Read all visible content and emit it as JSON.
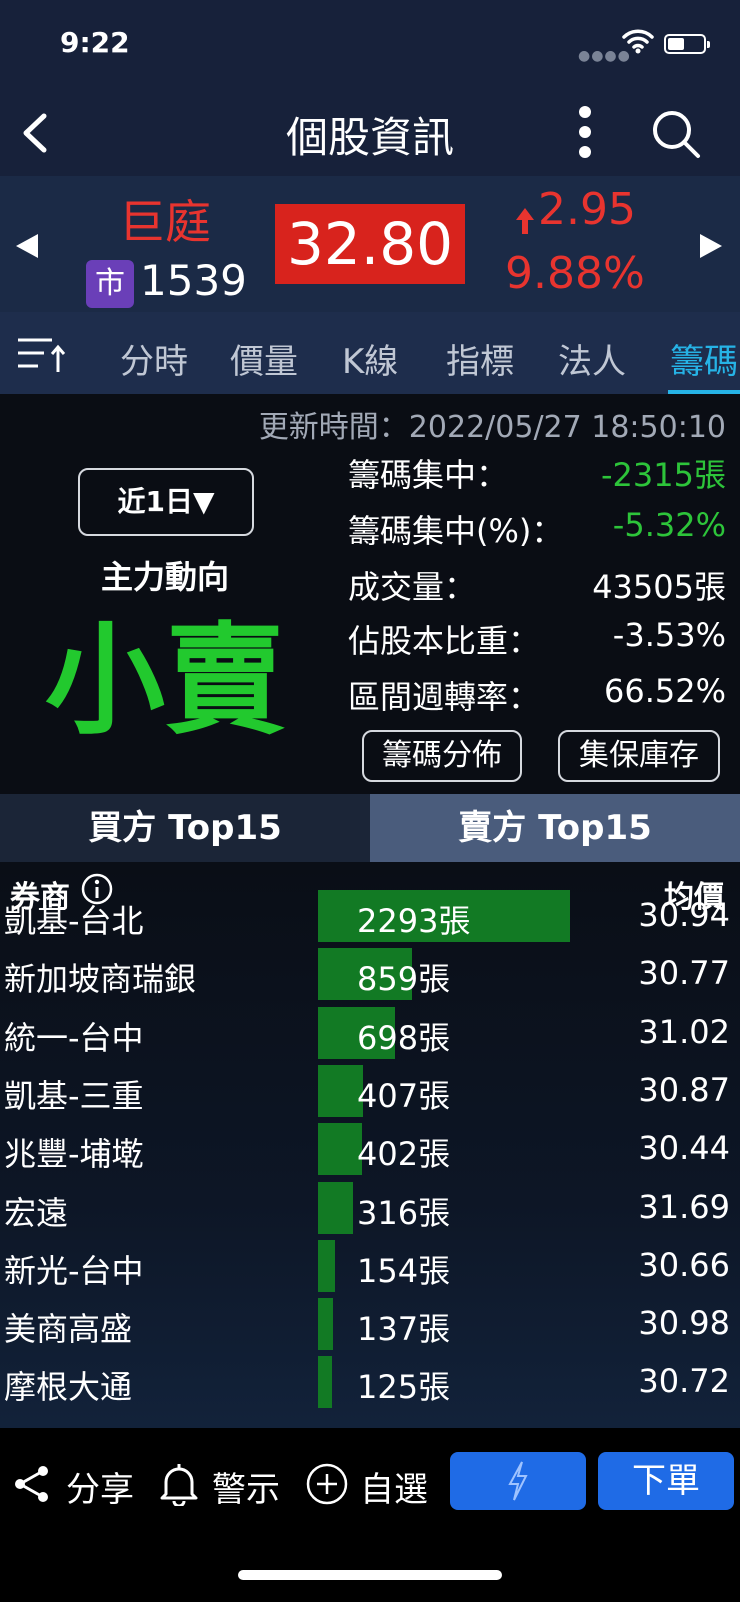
{
  "status": {
    "time": "9:22"
  },
  "nav": {
    "title": "個股資訊"
  },
  "stock": {
    "name": "巨庭",
    "market_badge": "市",
    "code": "1539",
    "price": "32.80",
    "change": "2.95",
    "change_pct": "9.88%",
    "up_color": "#e8342f"
  },
  "tabs": [
    {
      "label": "分時"
    },
    {
      "label": "價量"
    },
    {
      "label": "K線"
    },
    {
      "label": "指標"
    },
    {
      "label": "法人"
    },
    {
      "label": "籌碼"
    }
  ],
  "active_tab": "籌碼",
  "chip": {
    "update_time": "更新時間：2022/05/27 18:50:10",
    "period": "近1日▼",
    "main_force_label": "主力動向",
    "main_force_value": "小賣",
    "metrics": [
      {
        "label": "籌碼集中：",
        "value": "-2315張"
      },
      {
        "label": "籌碼集中(%)：",
        "value": "-5.32%"
      },
      {
        "label": "成交量：",
        "value": "43505張"
      },
      {
        "label": "佔股本比重：",
        "value": "-3.53%"
      },
      {
        "label": "區間週轉率：",
        "value": "66.52%"
      }
    ],
    "distribution_button": "籌碼分佈",
    "custody_button": "集保庫存"
  },
  "rank_tabs": {
    "buy": "買方 Top15",
    "sell": "賣方 Top15"
  },
  "table": {
    "header_broker": "券商",
    "header_avg": "均價",
    "max_volume": 2293,
    "rows": [
      {
        "name": "凱基-台北",
        "volume": 2293,
        "volume_text": "2293張",
        "avg": "30.94"
      },
      {
        "name": "新加坡商瑞銀",
        "volume": 859,
        "volume_text": "859張",
        "avg": "30.77"
      },
      {
        "name": "統一-台中",
        "volume": 698,
        "volume_text": "698張",
        "avg": "31.02"
      },
      {
        "name": "凱基-三重",
        "volume": 407,
        "volume_text": "407張",
        "avg": "30.87"
      },
      {
        "name": "兆豐-埔墘",
        "volume": 402,
        "volume_text": "402張",
        "avg": "30.44"
      },
      {
        "name": "宏遠",
        "volume": 316,
        "volume_text": "316張",
        "avg": "31.69"
      },
      {
        "name": "新光-台中",
        "volume": 154,
        "volume_text": "154張",
        "avg": "30.66"
      },
      {
        "name": "美商高盛",
        "volume": 137,
        "volume_text": "137張",
        "avg": "30.98"
      },
      {
        "name": "摩根大通",
        "volume": 125,
        "volume_text": "125張",
        "avg": "30.72"
      }
    ]
  },
  "bottom": {
    "share": "分享",
    "alert": "警示",
    "watchlist": "自選",
    "order": "下單"
  }
}
